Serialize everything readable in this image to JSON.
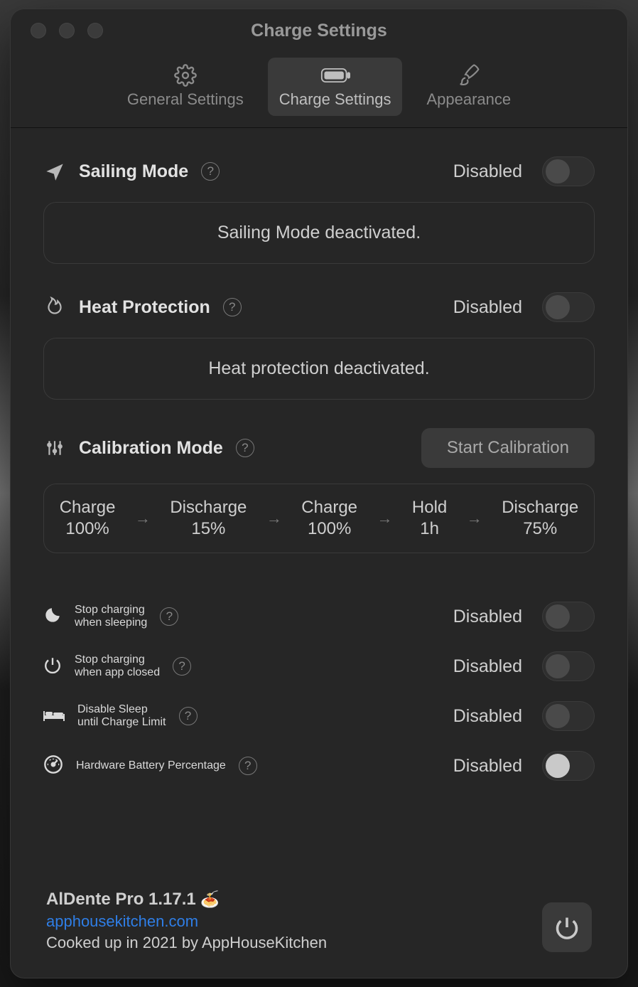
{
  "window_title": "Charge Settings",
  "tabs": {
    "general": "General Settings",
    "charge": "Charge Settings",
    "appearance": "Appearance"
  },
  "disabled_label": "Disabled",
  "sections": {
    "sailing": {
      "title": "Sailing Mode",
      "panel_text": "Sailing Mode deactivated."
    },
    "heat": {
      "title": "Heat Protection",
      "panel_text": "Heat protection deactivated."
    },
    "calibration": {
      "title": "Calibration Mode",
      "button": "Start Calibration",
      "steps": [
        {
          "line1": "Charge",
          "line2": "100%"
        },
        {
          "line1": "Discharge",
          "line2": "15%"
        },
        {
          "line1": "Charge",
          "line2": "100%"
        },
        {
          "line1": "Hold",
          "line2": "1h"
        },
        {
          "line1": "Discharge",
          "line2": "75%"
        }
      ]
    },
    "stop_sleeping": {
      "line1": "Stop charging",
      "line2": "when sleeping"
    },
    "stop_closed": {
      "line1": "Stop charging",
      "line2": "when app closed"
    },
    "disable_sleep": {
      "line1": "Disable Sleep",
      "line2": "until Charge Limit"
    },
    "hardware_pct": {
      "title": "Hardware Battery Percentage"
    }
  },
  "footer": {
    "app_name": "AlDente Pro 1.17.1",
    "link": "apphousekitchen.com",
    "credit": "Cooked up in 2021 by AppHouseKitchen"
  }
}
